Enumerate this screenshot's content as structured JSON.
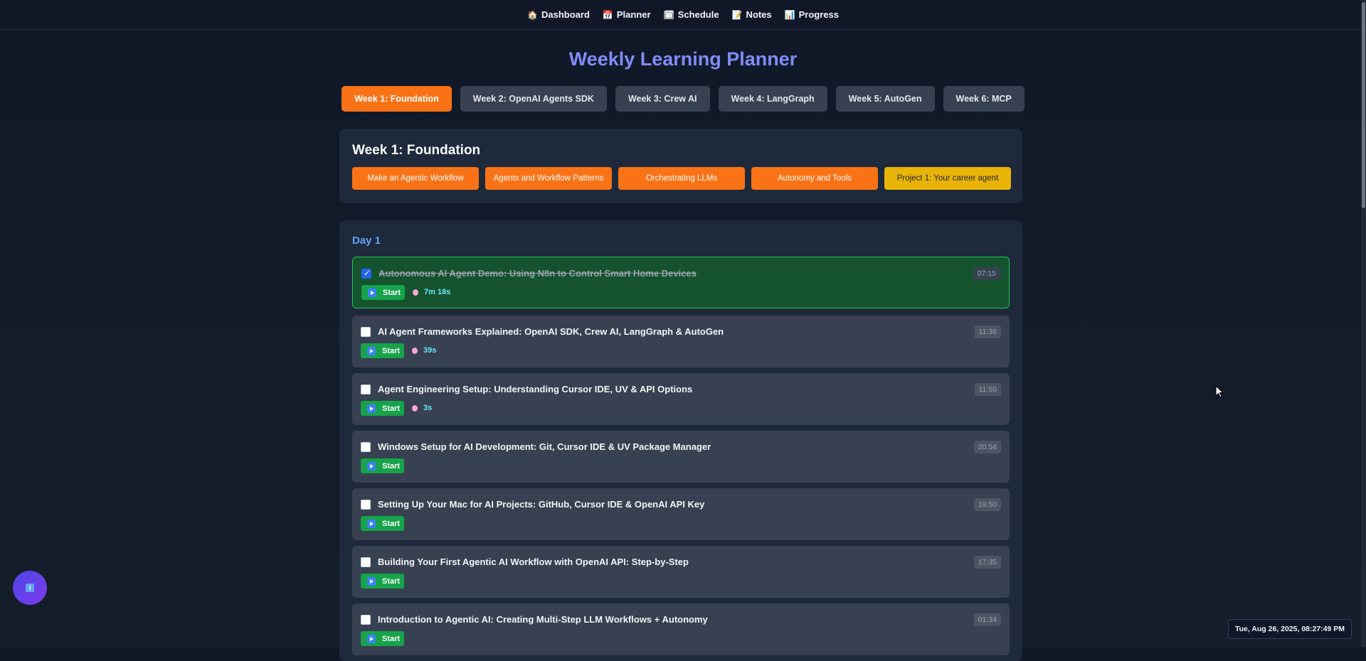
{
  "nav": [
    {
      "label": "Dashboard",
      "icon": "🏠"
    },
    {
      "label": "Planner",
      "icon": "📅"
    },
    {
      "label": "Schedule",
      "icon": "🗓"
    },
    {
      "label": "Notes",
      "icon": "📝"
    },
    {
      "label": "Progress",
      "icon": "📊"
    }
  ],
  "title": "Weekly Learning Planner",
  "weeks": [
    {
      "label": "Week 1: Foundation",
      "active": true
    },
    {
      "label": "Week 2: OpenAI Agents SDK"
    },
    {
      "label": "Week 3: Crew AI"
    },
    {
      "label": "Week 4: LangGraph"
    },
    {
      "label": "Week 5: AutoGen"
    },
    {
      "label": "Week 6: MCP"
    }
  ],
  "week_card": {
    "heading": "Week 1: Foundation",
    "topics": [
      "Make an Agentic Workflow",
      "Agents and Workflow Patterns",
      "Orchestrating LLMs",
      "Autonomy and Tools",
      "Project 1: Your career agent"
    ]
  },
  "day": {
    "title": "Day 1",
    "start_label": "Start",
    "lessons": [
      {
        "title": "Autonomous AI Agent Demo: Using N8n to Control Smart Home Devices",
        "duration": "07:15",
        "done": true,
        "time_spent": "7m 18s"
      },
      {
        "title": "AI Agent Frameworks Explained: OpenAI SDK, Crew AI, LangGraph & AutoGen",
        "duration": "11:36",
        "done": false,
        "time_spent": "39s"
      },
      {
        "title": "Agent Engineering Setup: Understanding Cursor IDE, UV & API Options",
        "duration": "11:50",
        "done": false,
        "time_spent": "3s"
      },
      {
        "title": "Windows Setup for AI Development: Git, Cursor IDE & UV Package Manager",
        "duration": "20:54",
        "done": false
      },
      {
        "title": "Setting Up Your Mac for AI Projects: GitHub, Cursor IDE & OpenAI API Key",
        "duration": "19:50",
        "done": false
      },
      {
        "title": "Building Your First Agentic AI Workflow with OpenAI API: Step-by-Step",
        "duration": "17:35",
        "done": false
      },
      {
        "title": "Introduction to Agentic AI: Creating Multi-Step LLM Workflows + Autonomy",
        "duration": "01:34",
        "done": false
      }
    ]
  },
  "clock": "Tue, Aug 26, 2025, 08:27:49 PM",
  "colors": {
    "accent": "#f97316",
    "project": "#eab308",
    "title": "#818cf8",
    "done": "#14532d",
    "start": "#16a34a"
  }
}
